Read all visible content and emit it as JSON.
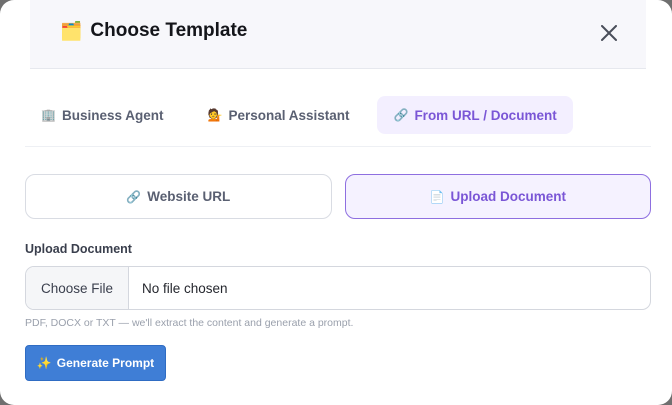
{
  "modal": {
    "title_icon": "🗂️",
    "title": "Choose Template",
    "close_icon": "close-icon"
  },
  "tabs": [
    {
      "icon": "🏢",
      "label": "Business Agent",
      "active": false
    },
    {
      "icon": "💁",
      "label": "Personal Assistant",
      "active": false
    },
    {
      "icon": "🔗",
      "label": "From URL / Document",
      "active": true
    }
  ],
  "source_toggle": [
    {
      "icon": "🔗",
      "label": "Website URL",
      "active": false
    },
    {
      "icon": "📄",
      "label": "Upload Document",
      "active": true
    }
  ],
  "upload": {
    "label": "Upload Document",
    "choose_label": "Choose File",
    "status": "No file chosen",
    "hint": "PDF, DOCX or TXT — we'll extract the content and generate a prompt."
  },
  "generate": {
    "icon": "✨",
    "label": "Generate Prompt"
  },
  "colors": {
    "accent": "#7a56d6",
    "primary_button": "#3f7ed6"
  }
}
